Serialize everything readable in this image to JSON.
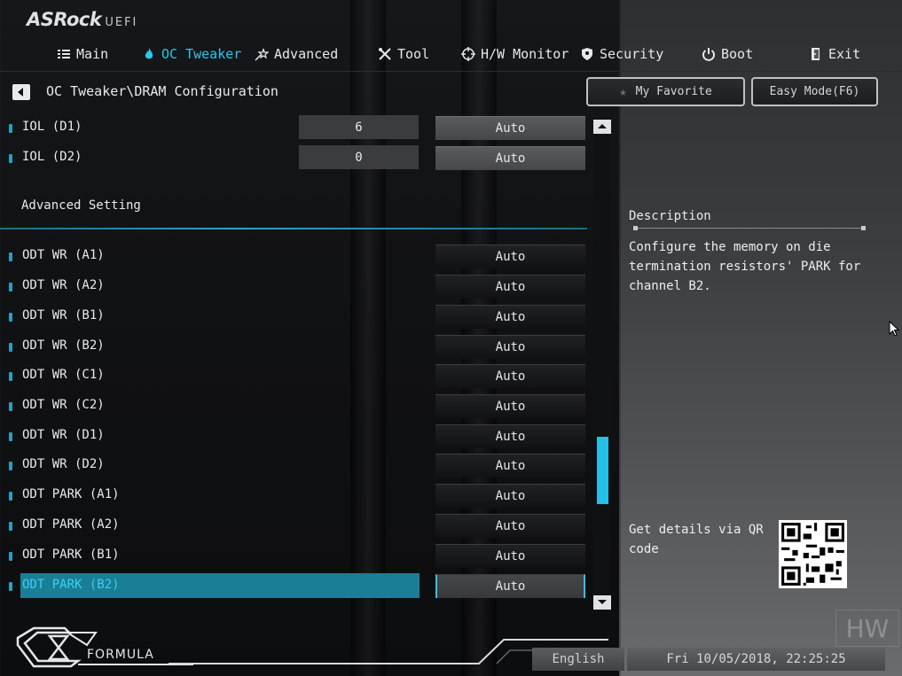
{
  "header": {
    "logo_text": "ASRock",
    "logo_sub": "UEFI"
  },
  "nav": {
    "items": [
      {
        "label": "Main",
        "icon": "list-icon"
      },
      {
        "label": "OC Tweaker",
        "icon": "flame-icon",
        "active": true
      },
      {
        "label": "Advanced",
        "icon": "star-wand-icon"
      },
      {
        "label": "Tool",
        "icon": "tools-icon"
      },
      {
        "label": "H/W Monitor",
        "icon": "crosshair-icon"
      },
      {
        "label": "Security",
        "icon": "shield-icon"
      },
      {
        "label": "Boot",
        "icon": "power-icon"
      },
      {
        "label": "Exit",
        "icon": "door-icon"
      }
    ]
  },
  "breadcrumb": "OC Tweaker\\DRAM Configuration",
  "buttons": {
    "favorite": "My Favorite",
    "easy_mode": "Easy Mode(F6)"
  },
  "settings_top": [
    {
      "label": "IOL (D1)",
      "value": "6",
      "option": "Auto"
    },
    {
      "label": "IOL (D2)",
      "value": "0",
      "option": "Auto"
    }
  ],
  "section_title": "Advanced Setting",
  "settings": [
    {
      "label": "ODT WR (A1)",
      "option": "Auto"
    },
    {
      "label": "ODT WR (A2)",
      "option": "Auto"
    },
    {
      "label": "ODT WR (B1)",
      "option": "Auto"
    },
    {
      "label": "ODT WR (B2)",
      "option": "Auto"
    },
    {
      "label": "ODT WR (C1)",
      "option": "Auto"
    },
    {
      "label": "ODT WR (C2)",
      "option": "Auto"
    },
    {
      "label": "ODT WR (D1)",
      "option": "Auto"
    },
    {
      "label": "ODT WR (D2)",
      "option": "Auto"
    },
    {
      "label": "ODT PARK (A1)",
      "option": "Auto"
    },
    {
      "label": "ODT PARK (A2)",
      "option": "Auto"
    },
    {
      "label": "ODT PARK (B1)",
      "option": "Auto"
    },
    {
      "label": "ODT PARK (B2)",
      "option": "Auto",
      "selected": true
    }
  ],
  "description": {
    "title": "Description",
    "text": "Configure the memory on die termination resistors' PARK for channel B2.",
    "qr_text": "Get details via QR code"
  },
  "footer": {
    "brand": "FORMULA",
    "language": "English",
    "datetime": "Fri 10/05/2018, 22:25:25"
  },
  "watermark": "HW",
  "colors": {
    "accent": "#2cc6ea",
    "selected_row": "#1a7e96",
    "scroll_thumb": "#26bfe6"
  },
  "scroll": {
    "position": 0.64
  }
}
